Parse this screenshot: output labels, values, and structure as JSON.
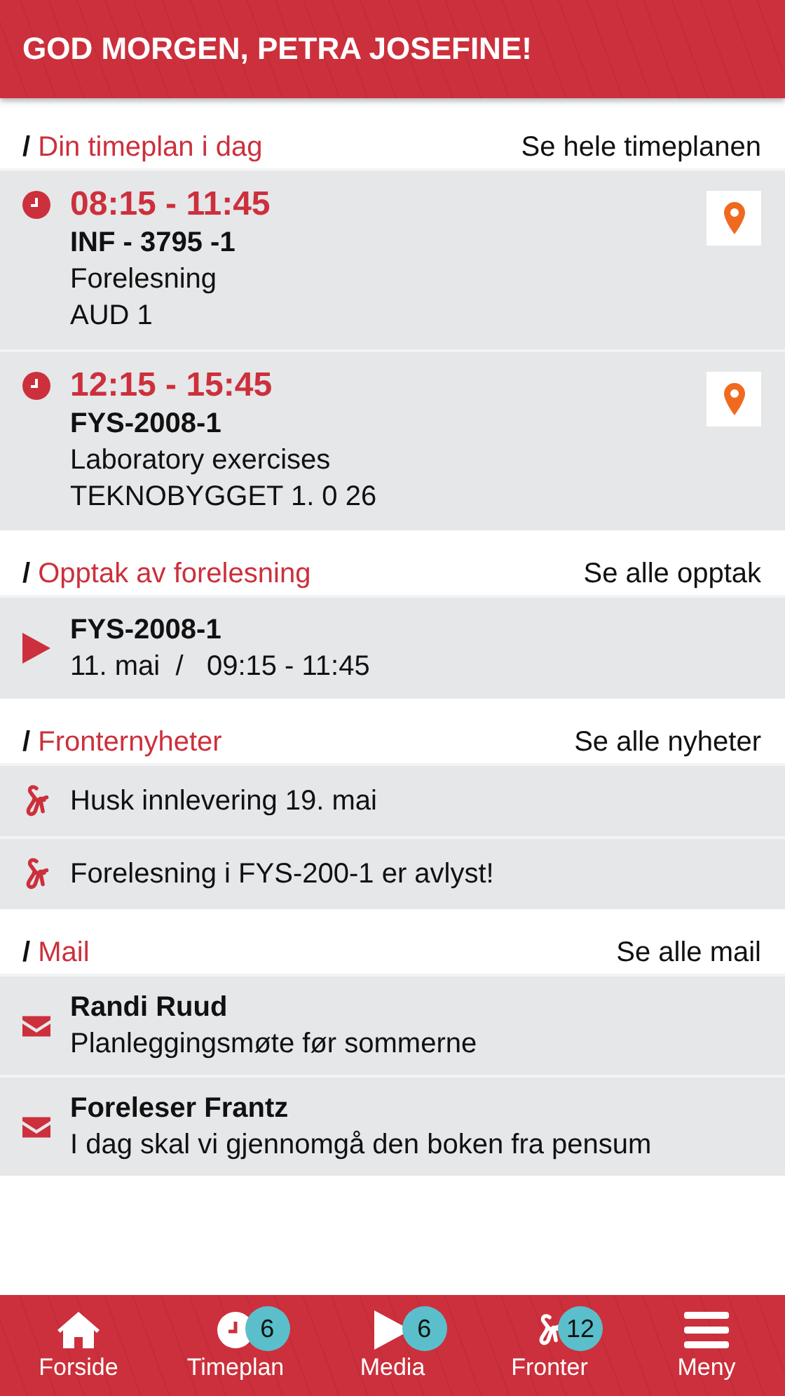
{
  "header": {
    "title": "GOD MORGEN, PETRA JOSEFINE!"
  },
  "sections": [
    {
      "kind": "schedule",
      "prefix": "/",
      "title": "Din timeplan i dag",
      "link": "Se hele timeplanen",
      "items": [
        {
          "time": "08:15 - 11:45",
          "course": "INF - 3795 -1",
          "type": "Forelesning",
          "room": "AUD 1"
        },
        {
          "time": "12:15 - 15:45",
          "course": "FYS-2008-1",
          "type": "Laboratory exercises",
          "room": "TEKNOBYGGET 1. 0 26"
        }
      ]
    },
    {
      "kind": "recording",
      "prefix": "/",
      "title": "Opptak av forelesning",
      "link": "Se alle opptak",
      "items": [
        {
          "course": "FYS-2008-1",
          "date": "11. mai",
          "separator": "/",
          "time": "09:15 - 11:45"
        }
      ]
    },
    {
      "kind": "news",
      "prefix": "/",
      "title": "Fronternyheter",
      "link": "Se alle nyheter",
      "items": [
        {
          "text": "Husk innlevering 19. mai"
        },
        {
          "text": "Forelesning i FYS-200-1 er avlyst!"
        }
      ]
    },
    {
      "kind": "mail",
      "prefix": "/",
      "title": "Mail",
      "link": "Se alle mail",
      "items": [
        {
          "sender": "Randi Ruud",
          "subject": "Planleggingsmøte før sommerne"
        },
        {
          "sender": "Foreleser Frantz",
          "subject": "I dag skal vi gjennomgå den boken fra pensum"
        }
      ]
    }
  ],
  "nav": [
    {
      "kind": "home",
      "label": "Forside"
    },
    {
      "kind": "clock",
      "label": "Timeplan",
      "badge": "6"
    },
    {
      "kind": "play",
      "label": "Media",
      "badge": "6"
    },
    {
      "kind": "fronter",
      "label": "Fronter",
      "badge": "12"
    },
    {
      "kind": "menu",
      "label": "Meny"
    }
  ]
}
